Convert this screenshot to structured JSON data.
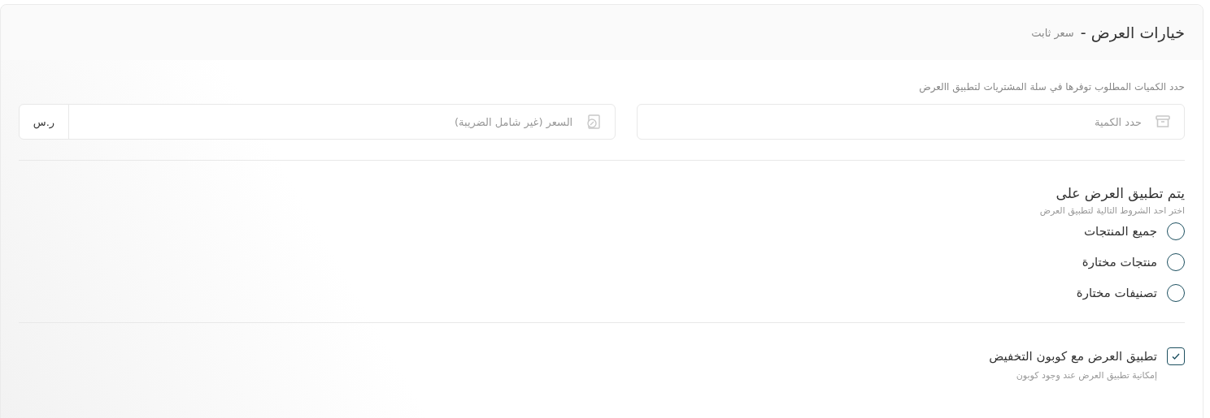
{
  "header": {
    "title": "خيارات العرض -",
    "subtitle": "سعر ثابت"
  },
  "quantity_section": {
    "label": "حدد الكميات المطلوب توفرها في سلة المشتريات لتطبيق االعرض",
    "quantity_field": {
      "placeholder": "حدد الكمية"
    },
    "price_field": {
      "placeholder": "السعر (غير شامل الضريبة)",
      "unit": "ر.س"
    }
  },
  "apply_section": {
    "title": "يتم تطبيق العرض على",
    "hint": "اختر احد الشروط التالية لتطبيق العرض",
    "options": [
      {
        "label": "جميع المنتجات",
        "selected": false
      },
      {
        "label": "منتجات مختارة",
        "selected": false
      },
      {
        "label": "تصنيفات مختارة",
        "selected": false
      }
    ]
  },
  "coupon": {
    "label": "تطبيق العرض مع كوبون التخفيض",
    "hint": "إمكانية تطبيق العرض عند وجود كوبون",
    "checked": true
  }
}
